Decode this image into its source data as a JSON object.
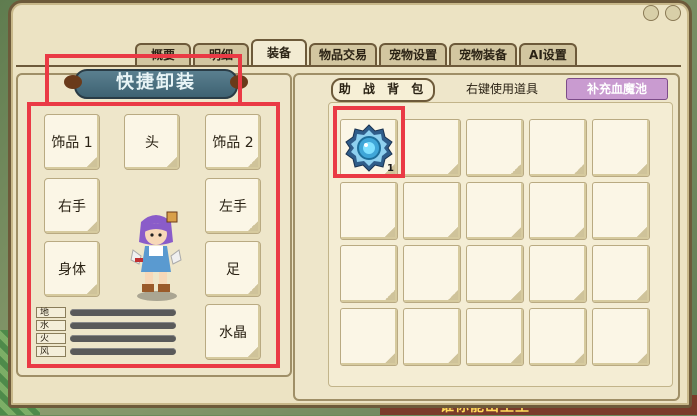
{
  "tabs": [
    {
      "label": "概要",
      "active": false
    },
    {
      "label": "明细",
      "active": false
    },
    {
      "label": "装备",
      "active": true
    },
    {
      "label": "物品交易",
      "active": false
    },
    {
      "label": "宠物设置",
      "active": false
    },
    {
      "label": "宠物装备",
      "active": false
    },
    {
      "label": "AI设置",
      "active": false
    }
  ],
  "left": {
    "title": "快捷卸装",
    "slots": {
      "accessory1": "饰品 1",
      "head": "头",
      "accessory2": "饰品 2",
      "right_hand": "右手",
      "left_hand": "左手",
      "body": "身体",
      "feet": "足",
      "crystal": "水晶"
    },
    "elements": [
      {
        "label": "地",
        "level": 0
      },
      {
        "label": "水",
        "level": 0
      },
      {
        "label": "火",
        "level": 0
      },
      {
        "label": "风",
        "level": 0
      }
    ]
  },
  "right": {
    "header": "助 战 背 包",
    "hint": "右键使用道具",
    "potion_button": "补充血魔池",
    "inventory": {
      "slot_count": 20,
      "items": [
        {
          "slot": 0,
          "icon": "blue-gem-ornament-icon",
          "quantity": "1"
        }
      ]
    }
  },
  "colors": {
    "highlight": "#ea3a45",
    "title_bg": "#4e7282",
    "potion_bg": "#c99bd0",
    "panel_bg": "#ece3c3"
  },
  "world": {
    "bottom_sign": "谁你能山王王"
  }
}
